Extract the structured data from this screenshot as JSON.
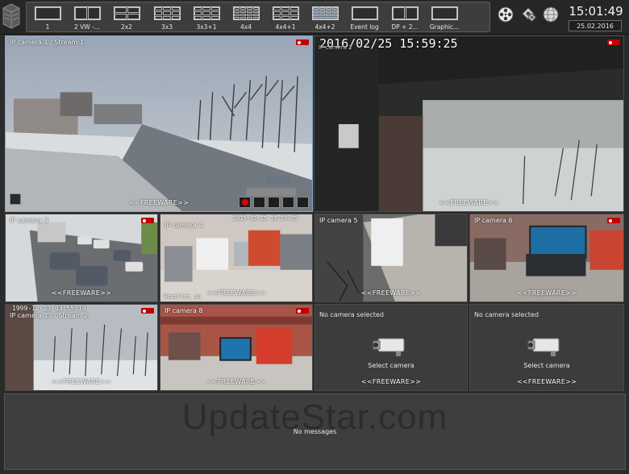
{
  "toolbar": {
    "layouts": [
      {
        "label": "1",
        "grid": "1x1",
        "active": false
      },
      {
        "label": "2 VW -...",
        "grid": "2x1",
        "active": false
      },
      {
        "label": "2x2",
        "grid": "2x2",
        "active": false
      },
      {
        "label": "3x3",
        "grid": "3x3",
        "active": false
      },
      {
        "label": "3x3+1",
        "grid": "3x3",
        "active": false
      },
      {
        "label": "4x4",
        "grid": "4x4",
        "active": false
      },
      {
        "label": "4x4+1",
        "grid": "3x3",
        "active": false
      },
      {
        "label": "4x4+2",
        "grid": "4x4",
        "active": true
      },
      {
        "label": "Event log",
        "grid": "1x1",
        "active": false
      },
      {
        "label": "DP + 2...",
        "grid": "2x1",
        "active": false
      },
      {
        "label": "Graphic...",
        "grid": "1x1",
        "active": false
      }
    ],
    "icons": [
      "film-reel-icon",
      "settings-gears-icon",
      "globe-icon"
    ]
  },
  "clock": {
    "time": "15:01:49",
    "date": "25.02.2016"
  },
  "cameras": {
    "cam1": {
      "name": "IP camera 1 / Stream 1",
      "freeware": "<<FREEWARE>>"
    },
    "cam2": {
      "osd": "2016/02/25 15:59:25",
      "name": "IP camera 2",
      "freeware": "<<FREEWARE>>"
    },
    "cam3": {
      "name": "IP camera 3",
      "freeware": "<<FREEWARE>>"
    },
    "cam4": {
      "name": "IP camera 4",
      "osd": "2015-02-25 15:59:25",
      "osd2": "Bouillet_au",
      "freeware": "<<FREEWARE>>"
    },
    "cam5": {
      "name": "IP camera 5",
      "freeware": "<<FREEWARE>>"
    },
    "cam6": {
      "name": "IP camera 6",
      "freeware": "<<FREEWARE>>"
    },
    "cam7": {
      "osd": "1999-12-23 03:55:19",
      "name": "IP camera 13 / Stream 2",
      "freeware": "<<FREEWARE>>"
    },
    "cam8": {
      "name": "IP camera 8",
      "freeware": "<<FREEWARE>>"
    },
    "empty1": {
      "title": "No camera selected",
      "action": "Select camera",
      "freeware": "<<FREEWARE>>"
    },
    "empty2": {
      "title": "No camera selected",
      "action": "Select camera",
      "freeware": "<<FREEWARE>>"
    }
  },
  "messages": {
    "text": "No messages",
    "watermark": "UpdateStar.com"
  },
  "colors": {
    "accent": "#7fa7d8",
    "record": "#c00000",
    "background": "#2b2b2b"
  }
}
